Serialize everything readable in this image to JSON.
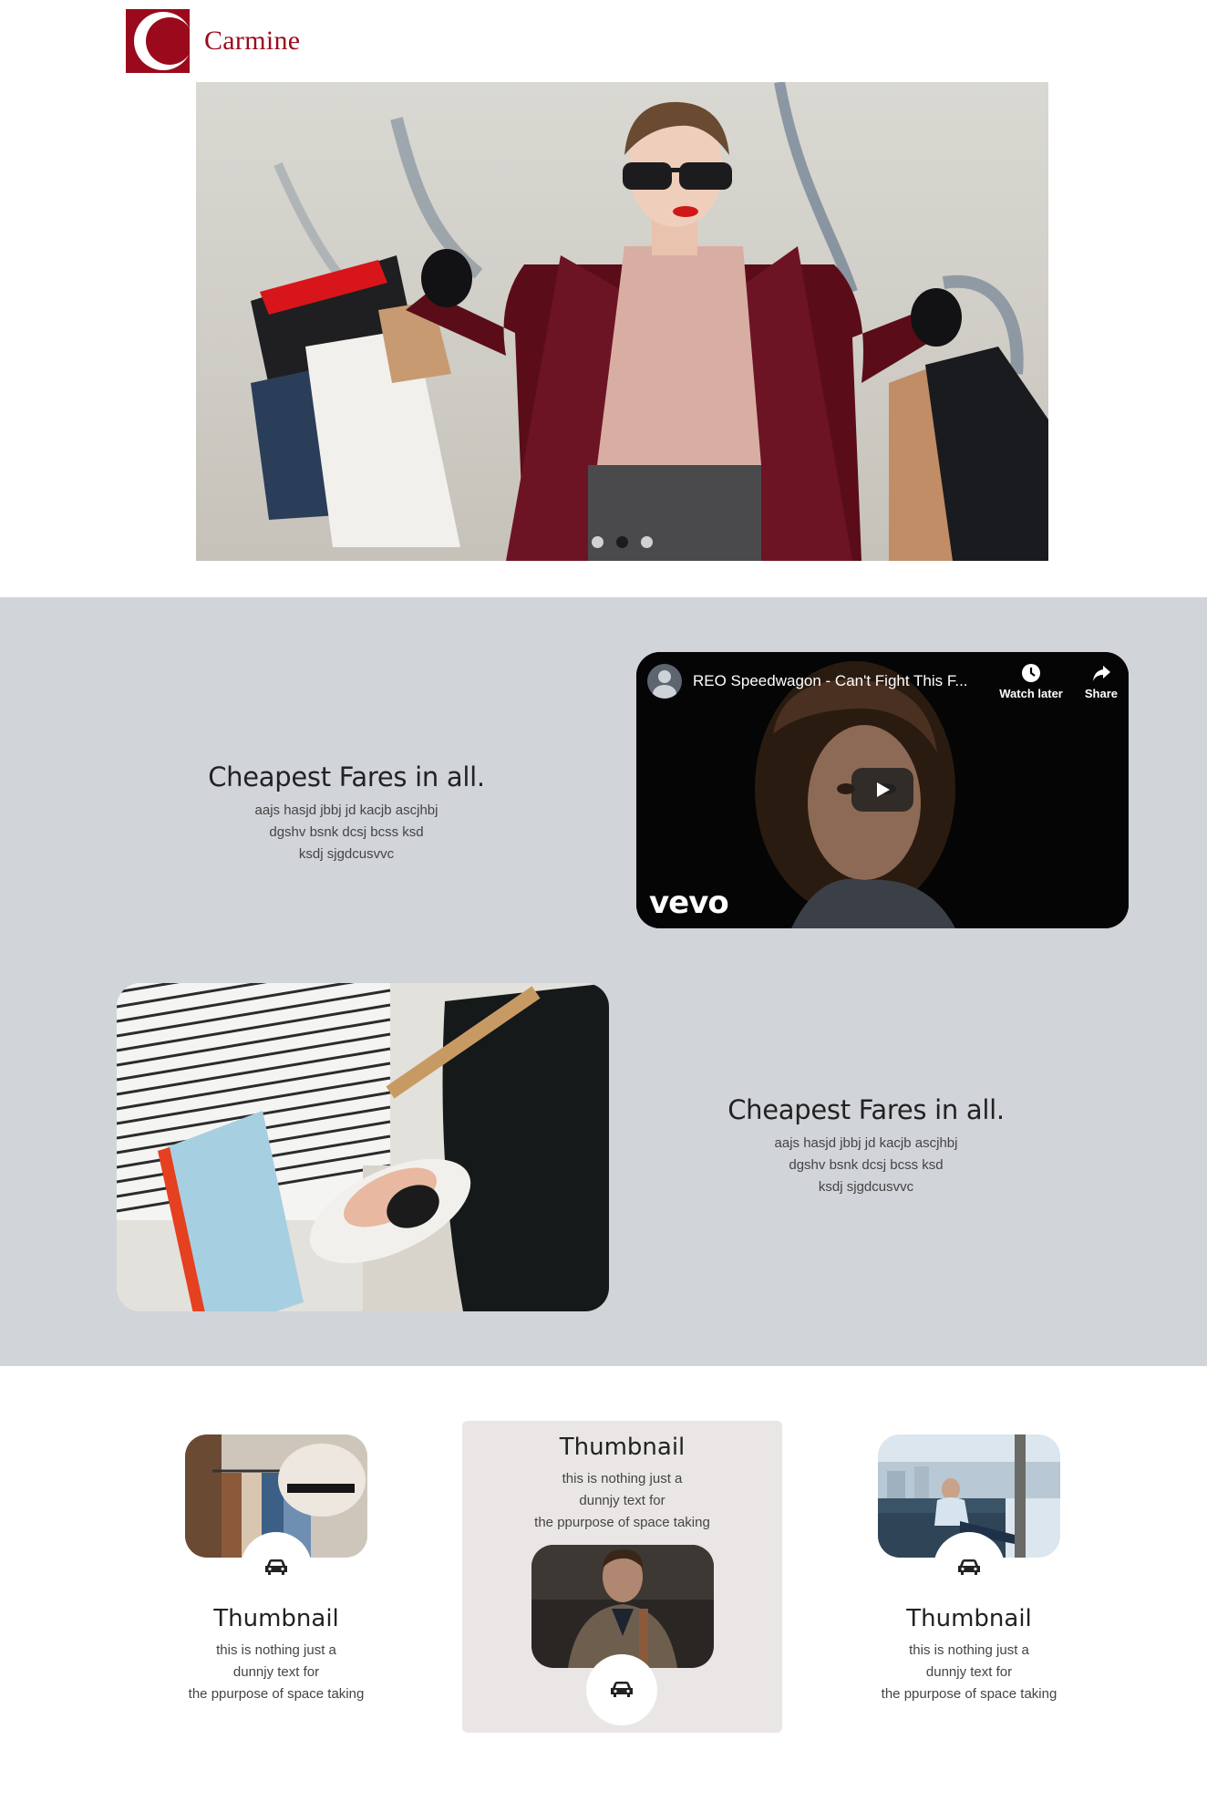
{
  "brand": {
    "name": "Carmine",
    "logo_letter": "C",
    "color": "#9b0a1c"
  },
  "carousel": {
    "slide_count": 3,
    "active_index": 1
  },
  "features": [
    {
      "title": "Cheapest Fares in all.",
      "lines": [
        "aajs hasjd jbbj jd kacjb ascjhbj",
        "dgshv bsnk dcsj bcss ksd",
        "ksdj sjgdcusvvc"
      ]
    },
    {
      "title": "Cheapest Fares in all.",
      "lines": [
        "aajs hasjd jbbj jd kacjb ascjhbj",
        "dgshv bsnk dcsj bcss ksd",
        "ksdj sjgdcusvvc"
      ]
    }
  ],
  "video": {
    "title": "REO Speedwagon - Can't Fight This F...",
    "watch_later": "Watch later",
    "share": "Share",
    "channel_mark": "vevo"
  },
  "thumbnails": [
    {
      "title": "Thumbnail",
      "lines": [
        "this is nothing just a",
        "dunnjy text for",
        "the ppurpose of space taking"
      ],
      "icon": "car-icon"
    },
    {
      "title": "Thumbnail",
      "lines": [
        "this is nothing just a",
        "dunnjy text for",
        "the ppurpose of space taking"
      ],
      "icon": "car-icon"
    },
    {
      "title": "Thumbnail",
      "lines": [
        "this is nothing just a",
        "dunnjy text for",
        "the ppurpose of space taking"
      ],
      "icon": "car-icon"
    }
  ],
  "colors": {
    "section_bg": "#d1d4d8",
    "card_bg": "#ebe6e6",
    "accent": "#9b0a1c"
  }
}
